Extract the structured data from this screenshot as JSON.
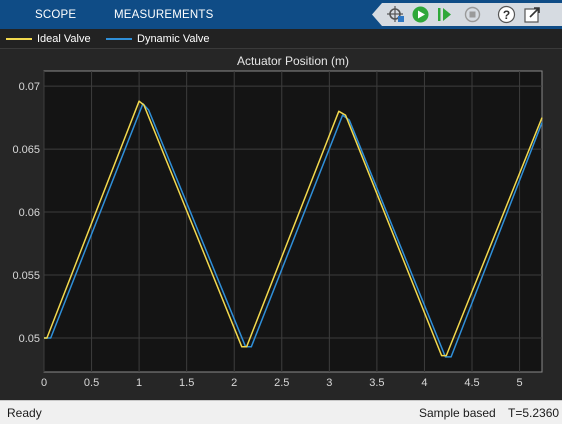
{
  "toolstrip": {
    "tabs": [
      {
        "label": "SCOPE"
      },
      {
        "label": "MEASUREMENTS"
      }
    ],
    "icons": [
      "highlight-simulink-block-icon",
      "run-icon",
      "step-forward-icon",
      "stop-icon",
      "help-icon",
      "undock-icon"
    ],
    "colors": {
      "background": "#0f4c86",
      "run": "#2fa83a",
      "stop": "#8c8c8c"
    }
  },
  "legend": {
    "items": [
      {
        "label": "Ideal Valve",
        "color": "#f2d94e"
      },
      {
        "label": "Dynamic Valve",
        "color": "#2f8fd8"
      }
    ]
  },
  "status": {
    "left": "Ready",
    "mode": "Sample based",
    "time": "T=5.2360"
  },
  "chart_data": {
    "type": "line",
    "title": "Actuator Position (m)",
    "xlabel": "",
    "ylabel": "",
    "xlim": [
      0,
      5.236
    ],
    "ylim": [
      0.0473,
      0.0712
    ],
    "x_ticks": [
      0,
      0.5,
      1,
      1.5,
      2,
      2.5,
      3,
      3.5,
      4,
      4.5,
      5
    ],
    "x_tick_labels": [
      "0",
      "0.5",
      "1",
      "1.5",
      "2",
      "2.5",
      "3",
      "3.5",
      "4",
      "4.5",
      "5"
    ],
    "y_ticks": [
      0.05,
      0.055,
      0.06,
      0.065,
      0.07
    ],
    "y_tick_labels": [
      "0.05",
      "0.055",
      "0.06",
      "0.065",
      "0.07"
    ],
    "grid": true,
    "legend_position": "top",
    "series": [
      {
        "name": "Ideal Valve",
        "color": "#f2d94e",
        "x": [
          0,
          0.03,
          1.0,
          1.05,
          2.08,
          2.13,
          3.1,
          3.17,
          4.18,
          4.23,
          5.236
        ],
        "y": [
          0.05,
          0.05,
          0.0688,
          0.0685,
          0.0493,
          0.0493,
          0.068,
          0.0677,
          0.0486,
          0.0486,
          0.0675
        ]
      },
      {
        "name": "Dynamic Valve",
        "color": "#2f8fd8",
        "x": [
          0,
          0.07,
          1.04,
          1.1,
          2.12,
          2.18,
          3.14,
          3.21,
          4.22,
          4.28,
          5.236
        ],
        "y": [
          0.05,
          0.05,
          0.0686,
          0.0681,
          0.0493,
          0.0493,
          0.0677,
          0.0673,
          0.0485,
          0.0485,
          0.0671
        ]
      }
    ]
  }
}
